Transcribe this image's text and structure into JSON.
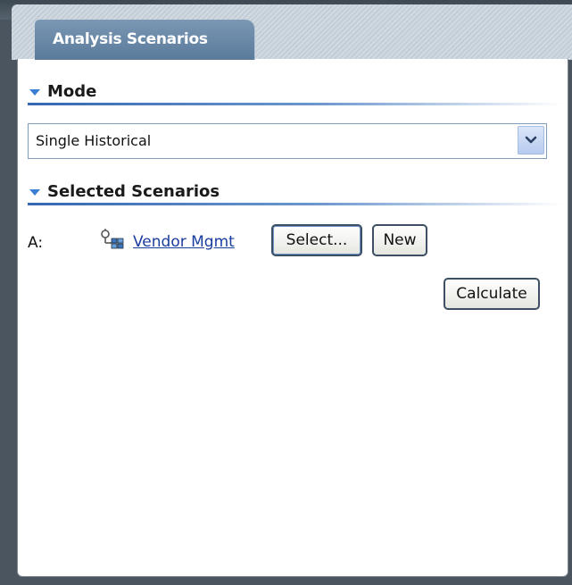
{
  "tab": {
    "label": "Analysis Scenarios"
  },
  "mode": {
    "header": "Mode",
    "select": {
      "selected": "Single Historical"
    }
  },
  "selected_scenarios": {
    "header": "Selected Scenarios",
    "rows": [
      {
        "label": "A:",
        "icon": "scenario-icon",
        "link": "Vendor Mgmt",
        "select_button": "Select...",
        "new_button": "New"
      }
    ]
  },
  "actions": {
    "calculate": "Calculate"
  },
  "colors": {
    "tab_background": "#6b89a8",
    "section_rule": "#3667b1",
    "collapse_triangle": "#3a7fd3",
    "link": "#1a3da0",
    "frame": "#4a5560"
  }
}
